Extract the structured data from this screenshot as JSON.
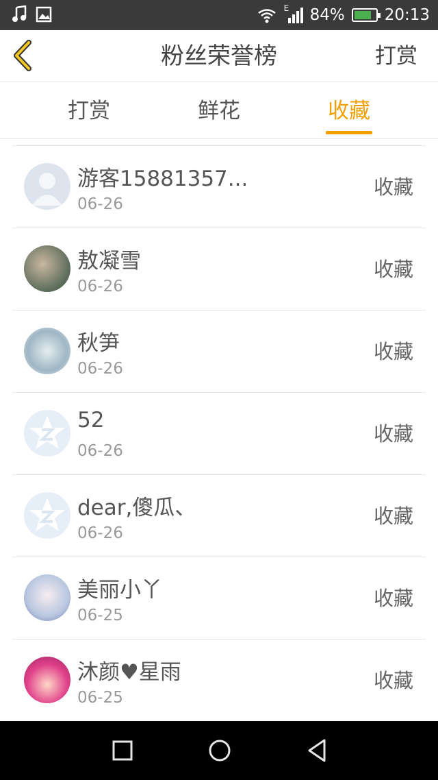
{
  "status_bar": {
    "network_label": "E",
    "battery": "84%",
    "battery_level": 0.84,
    "time": "20:13",
    "icons": [
      "music-note-icon",
      "image-icon",
      "wifi-icon",
      "signal-icon",
      "battery-icon"
    ]
  },
  "header": {
    "title": "粉丝荣誉榜",
    "right_label": "打赏"
  },
  "tabs": [
    {
      "label": "打赏"
    },
    {
      "label": "鲜花"
    },
    {
      "label": "收藏",
      "active": true
    }
  ],
  "accent_color": "#f0a000",
  "list": [
    {
      "name": "游客15881357...",
      "date": "06-26",
      "action": "收藏"
    },
    {
      "name": "敖凝雪",
      "date": "06-26",
      "action": "收藏"
    },
    {
      "name": "秋笋",
      "date": "06-26",
      "action": "收藏"
    },
    {
      "name": "52",
      "date": "06-26",
      "action": "收藏"
    },
    {
      "name": "dear,傻瓜、",
      "date": "06-26",
      "action": "收藏"
    },
    {
      "name": "美丽小丫",
      "date": "06-25",
      "action": "收藏"
    },
    {
      "name": "沐颜♥星雨",
      "date": "06-25",
      "action": "收藏"
    }
  ]
}
